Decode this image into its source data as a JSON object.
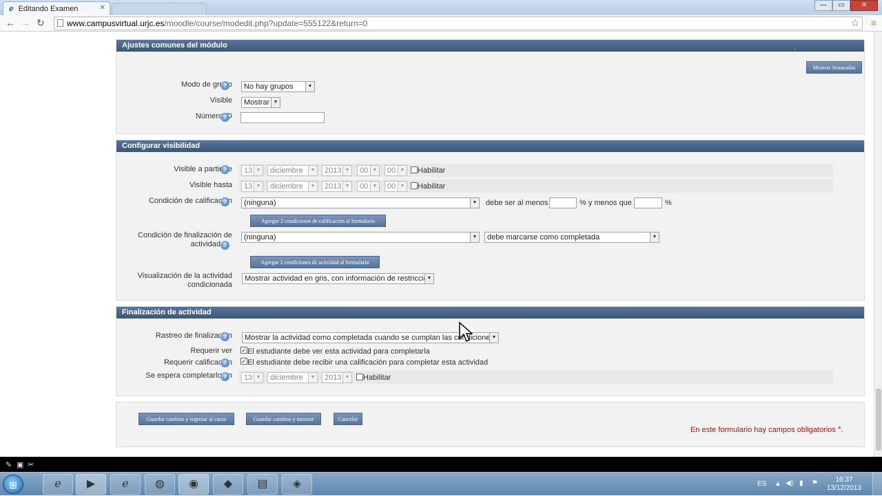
{
  "browser": {
    "tab_title": "Editando Examen",
    "tab_close": "✕",
    "url_host": "www.campusvirtual.urjc.es",
    "url_path": "/moodle/course/modedit.php?update=555122&return=0",
    "window_controls": [
      "—",
      "▭",
      "✕"
    ]
  },
  "sections": {
    "common": {
      "title": "Ajustes comunes del módulo",
      "advanced_button": "Mostrar Avanzadas",
      "group_mode_label": "Modo de grupo",
      "group_mode_value": "No hay grupos",
      "visible_label": "Visible",
      "visible_value": "Mostrar",
      "id_number_label": "Número ID",
      "id_number_value": ""
    },
    "visibility": {
      "title": "Configurar visibilidad",
      "from_label": "Visible a partir de",
      "until_label": "Visible hasta",
      "day": "13",
      "month": "diciembre",
      "year": "2013",
      "hour": "00",
      "minute": "00",
      "enable_label": "Habilitar",
      "grade_condition_label": "Condición de calificación",
      "grade_condition_value": "(ninguna)",
      "at_least_text": "debe ser al menos",
      "and_less_text": "% y menos que",
      "percent": "%",
      "add_grade_button": "Agregar 2 condiciones de calificación al formulario",
      "completion_condition_label_1": "Condición de finalización de",
      "completion_condition_label_2": "actividad",
      "completion_condition_value": "(ninguna)",
      "completion_state_value": "debe marcarse como completada",
      "add_activity_button": "Agregar 2 condiciones de actividad al formulario",
      "display_label_1": "Visualización de la actividad",
      "display_label_2": "condicionada",
      "display_value": "Mostrar actividad en gris, con información de restricción"
    },
    "completion": {
      "title": "Finalización de actividad",
      "tracking_label": "Rastreo de finalización",
      "tracking_value": "Mostrar la actividad como completada cuando se cumplan las condiciones",
      "require_view_label": "Requerir ver",
      "require_view_text": "El estudiante debe ver esta actividad para completarla",
      "require_grade_label": "Requerir calificación",
      "require_grade_text": "El estudiante debe recibir una calificación para completar esta actividad",
      "expected_label": "Se espera completarlo en",
      "day": "13",
      "month": "diciembre",
      "year": "2013",
      "enable_label": "Habilitar"
    }
  },
  "footer": {
    "save_return": "Guardar cambios y regresar al curso",
    "save_show": "Guardar cambios y mostrar",
    "cancel": "Cancelar",
    "required_note": "En este formulario hay campos obligatorios",
    "required_star": "*."
  },
  "taskbar": {
    "lang": "ES",
    "time": "16:37",
    "date": "13/12/2013"
  }
}
